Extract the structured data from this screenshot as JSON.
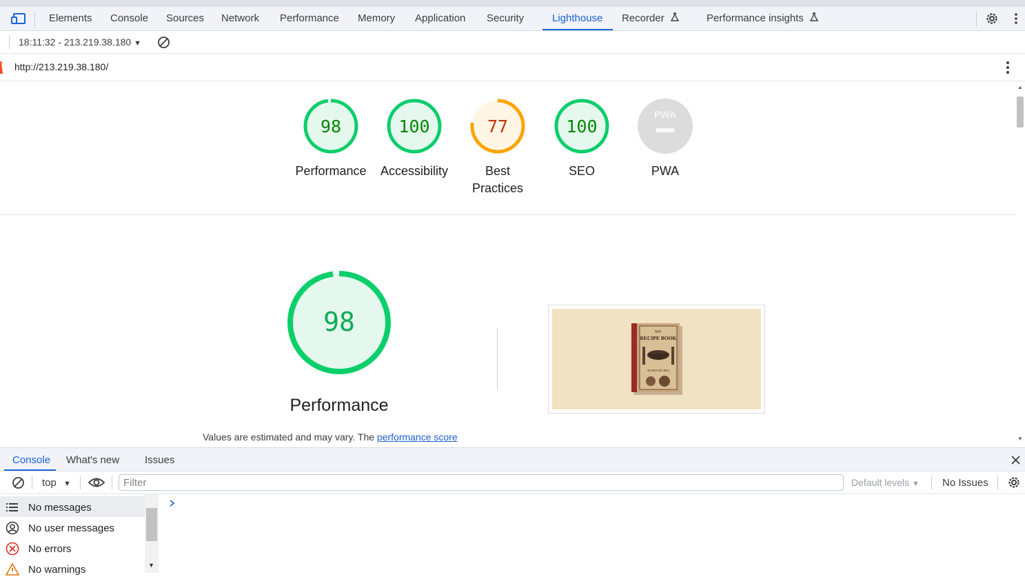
{
  "devtools": {
    "tabs": [
      "Elements",
      "Console",
      "Sources",
      "Network",
      "Performance",
      "Memory",
      "Application",
      "Security",
      "Lighthouse",
      "Recorder",
      "Performance insights"
    ],
    "active_tab": "Lighthouse",
    "report_selector": "18:11:32 - 213.219.38.180",
    "url": "http://213.219.38.180/"
  },
  "scores": [
    {
      "label": "Performance",
      "score": "98",
      "status": "pass"
    },
    {
      "label": "Accessibility",
      "score": "100",
      "status": "pass"
    },
    {
      "label": "Best Practices",
      "label_line1": "Best",
      "label_line2": "Practices",
      "score": "77",
      "status": "average"
    },
    {
      "label": "SEO",
      "score": "100",
      "status": "pass"
    },
    {
      "label": "PWA",
      "score": "",
      "badge_text": "PWA",
      "status": "na"
    }
  ],
  "performance_section": {
    "score": "98",
    "title": "Performance",
    "note_prefix": "Values are estimated and may vary. The ",
    "note_link": "performance score"
  },
  "screenshot_thumbnail": {
    "book_title_small": "MY",
    "book_title": "RECIPE BOOK",
    "book_subtitle": "SECRET RECIPES"
  },
  "drawer": {
    "tabs": [
      "Console",
      "What's new",
      "Issues"
    ],
    "active_tab": "Console",
    "context": "top",
    "filter_placeholder": "Filter",
    "levels": "Default levels",
    "issues": "No Issues",
    "sidebar": [
      "No messages",
      "No user messages",
      "No errors",
      "No warnings"
    ]
  },
  "colors": {
    "pass": "#0cce6b",
    "pass_fill": "#e5f8ee",
    "pass_text": "#008800",
    "average": "#ffa400",
    "average_fill": "#fff6e6",
    "average_text": "#c33300",
    "na": "#cccccc",
    "accent": "#1a62d6"
  }
}
